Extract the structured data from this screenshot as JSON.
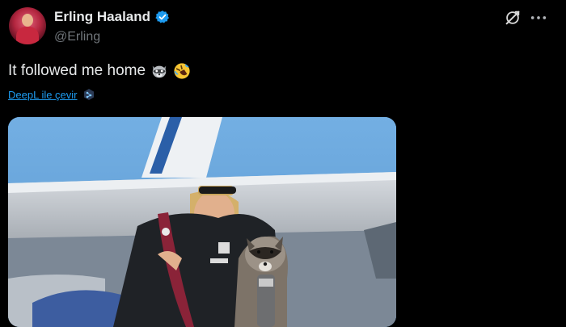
{
  "author": {
    "name": "Erling Haaland",
    "handle": "@Erling",
    "verified": true
  },
  "tweet": {
    "text": "It followed me home",
    "emojis": [
      "raccoon-emoji",
      "rolling-laughing-emoji"
    ]
  },
  "translate": {
    "label": "DeepL ile çevir",
    "icon": "deepl-icon"
  },
  "colors": {
    "background": "#000000",
    "text": "#e7e9ea",
    "secondary": "#71767b",
    "accent": "#1d9bf0"
  },
  "icons": [
    "grok-icon",
    "more-icon",
    "verified-badge-icon"
  ]
}
